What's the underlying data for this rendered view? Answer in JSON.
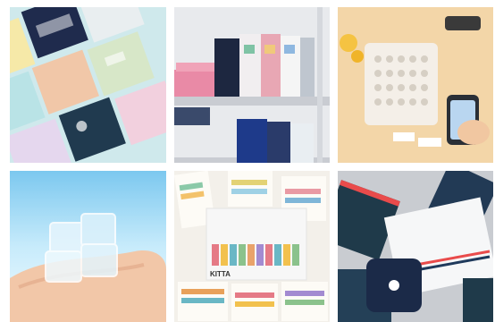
{
  "grid": {
    "tiles": [
      {
        "subject": "pastel-binder-covers"
      },
      {
        "subject": "file-boxes-on-shelf"
      },
      {
        "subject": "label-printer-and-phone"
      },
      {
        "subject": "hand-holding-clear-stamp-block"
      },
      {
        "subject": "kitta-washi-tape-sheets",
        "brand_text": "KITTA"
      },
      {
        "subject": "navy-stationery-and-case"
      }
    ]
  },
  "colors": {
    "background": "#ffffff",
    "tile_1": "#cfe9ec",
    "tile_2": "#e8eaed",
    "tile_3": "#f3d6a8",
    "tile_4": "#9fd7f2",
    "tile_5": "#f3f0ea",
    "tile_6": "#c9ccd1"
  }
}
